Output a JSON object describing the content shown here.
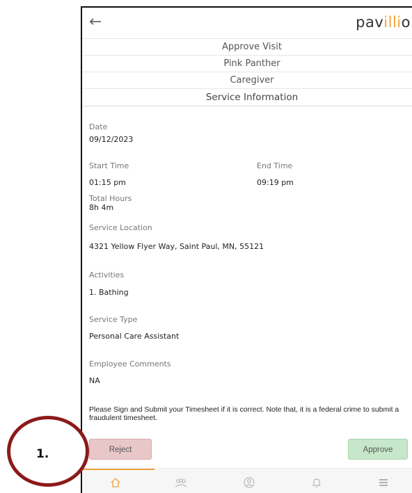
{
  "header": {
    "logo_prefix": "pav",
    "logo_accent": "illi",
    "logo_suffix": "o"
  },
  "rows": {
    "approve_visit": "Approve Visit",
    "name": "Pink Panther",
    "role": "Caregiver",
    "section_title": "Service Information"
  },
  "fields": {
    "date_label": "Date",
    "date_value": "09/12/2023",
    "start_label": "Start Time",
    "start_value": "01:15 pm",
    "end_label": "End Time",
    "end_value": "09:19 pm",
    "total_label": "Total Hours",
    "total_value": "8h 4m",
    "location_label": "Service Location",
    "location_value": "4321 Yellow Flyer Way, Saint Paul, MN, 55121",
    "activities_label": "Activities",
    "activities_value": "1. Bathing",
    "type_label": "Service Type",
    "type_value": "Personal Care Assistant",
    "comments_label": "Employee Comments",
    "comments_value": "NA"
  },
  "notice": "Please Sign and Submit your Timesheet if it is correct. Note that, it is a federal crime to submit a fraudulent timesheet.",
  "buttons": {
    "reject": "Reject",
    "approve": "Approve"
  },
  "callout": {
    "label": "1."
  },
  "colors": {
    "accent": "#f2a33a",
    "reject_bg": "#e9c7c9",
    "approve_bg": "#c6e7c9",
    "callout": "#8c1a1a"
  }
}
